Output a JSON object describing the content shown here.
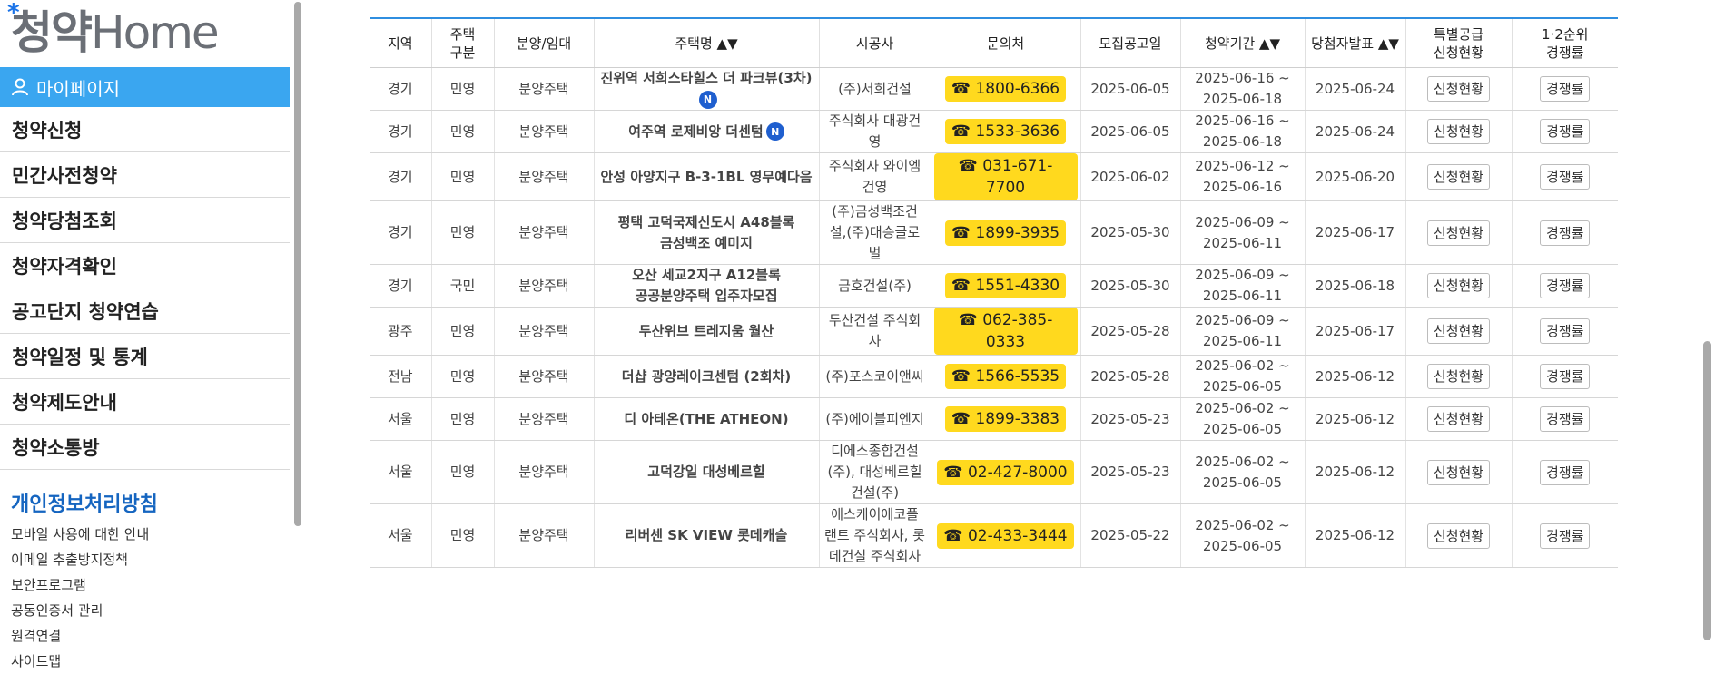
{
  "sidebar": {
    "logo_ko": "청약",
    "logo_home": "Home",
    "mypage": "마이페이지",
    "menu": [
      "청약신청",
      "민간사전청약",
      "청약당첨조회",
      "청약자격확인",
      "공고단지 청약연습",
      "청약일정 및 통계",
      "청약제도안내",
      "청약소통방"
    ],
    "privacy": "개인정보처리방침",
    "links": [
      "모바일 사용에 대한 안내",
      "이메일 추출방지정책",
      "보안프로그램",
      "공동인증서 관리",
      "원격연결",
      "사이트맵"
    ]
  },
  "table": {
    "headers": [
      "지역",
      "주택\n구분",
      "분양/임대",
      "주택명 ▲▼",
      "시공사",
      "문의처",
      "모집공고일",
      "청약기간 ▲▼",
      "당첨자발표 ▲▼",
      "특별공급\n신청현황",
      "1·2순위\n경쟁률"
    ],
    "btn_apply": "신청현황",
    "btn_rate": "경쟁률",
    "rows": [
      {
        "region": "경기",
        "type": "민영",
        "supply": "분양주택",
        "name": "진위역 서희스타힐스 더 파크뷰(3차)",
        "is_new": true,
        "builder": "(주)서희건설",
        "phone": "☎ 1800-6366",
        "notice": "2025-06-05",
        "period": "2025-06-16 ~\n2025-06-18",
        "announce": "2025-06-24"
      },
      {
        "region": "경기",
        "type": "민영",
        "supply": "분양주택",
        "name": "여주역 로제비앙 더센텀",
        "is_new": true,
        "builder": "주식회사 대광건\n영",
        "phone": "☎ 1533-3636",
        "notice": "2025-06-05",
        "period": "2025-06-16 ~\n2025-06-18",
        "announce": "2025-06-24"
      },
      {
        "region": "경기",
        "type": "민영",
        "supply": "분양주택",
        "name": "안성 아양지구 B-3-1BL 영무예다음",
        "is_new": false,
        "builder": "주식회사 와이엠\n건영",
        "phone": "☎ 031-671-7700",
        "notice": "2025-06-02",
        "period": "2025-06-12 ~\n2025-06-16",
        "announce": "2025-06-20"
      },
      {
        "region": "경기",
        "type": "민영",
        "supply": "분양주택",
        "name": "평택 고덕국제신도시 A48블록\n금성백조 예미지",
        "is_new": false,
        "builder": "(주)금성백조건\n설,(주)대승글로\n벌",
        "phone": "☎ 1899-3935",
        "notice": "2025-05-30",
        "period": "2025-06-09 ~\n2025-06-11",
        "announce": "2025-06-17"
      },
      {
        "region": "경기",
        "type": "국민",
        "supply": "분양주택",
        "name": "오산 세교2지구 A12블록\n공공분양주택 입주자모집",
        "is_new": false,
        "builder": "금호건설(주)",
        "phone": "☎ 1551-4330",
        "notice": "2025-05-30",
        "period": "2025-06-09 ~\n2025-06-11",
        "announce": "2025-06-18"
      },
      {
        "region": "광주",
        "type": "민영",
        "supply": "분양주택",
        "name": "두산위브 트레지움 월산",
        "is_new": false,
        "builder": "두산건설 주식회\n사",
        "phone": "☎ 062-385-0333",
        "notice": "2025-05-28",
        "period": "2025-06-09 ~\n2025-06-11",
        "announce": "2025-06-17"
      },
      {
        "region": "전남",
        "type": "민영",
        "supply": "분양주택",
        "name": "더샵 광양레이크센텀 (2회차)",
        "is_new": false,
        "builder": "(주)포스코이앤씨",
        "phone": "☎ 1566-5535",
        "notice": "2025-05-28",
        "period": "2025-06-02 ~\n2025-06-05",
        "announce": "2025-06-12"
      },
      {
        "region": "서울",
        "type": "민영",
        "supply": "분양주택",
        "name": "디 아테온(THE ATHEON)",
        "is_new": false,
        "builder": "(주)에이블피엔지",
        "phone": "☎ 1899-3383",
        "notice": "2025-05-23",
        "period": "2025-06-02 ~\n2025-06-05",
        "announce": "2025-06-12"
      },
      {
        "region": "서울",
        "type": "민영",
        "supply": "분양주택",
        "name": "고덕강일 대성베르힐",
        "is_new": false,
        "builder": "디에스종합건설\n(주), 대성베르힐\n건설(주)",
        "phone": "☎ 02-427-8000",
        "notice": "2025-05-23",
        "period": "2025-06-02 ~\n2025-06-05",
        "announce": "2025-06-12"
      },
      {
        "region": "서울",
        "type": "민영",
        "supply": "분양주택",
        "name": "리버센 SK VIEW 롯데캐슬",
        "is_new": false,
        "builder": "에스케이에코플\n랜트 주식회사, 롯\n데건설 주식회사",
        "phone": "☎ 02-433-3444",
        "notice": "2025-05-22",
        "period": "2025-06-02 ~\n2025-06-05",
        "announce": "2025-06-12"
      }
    ]
  }
}
